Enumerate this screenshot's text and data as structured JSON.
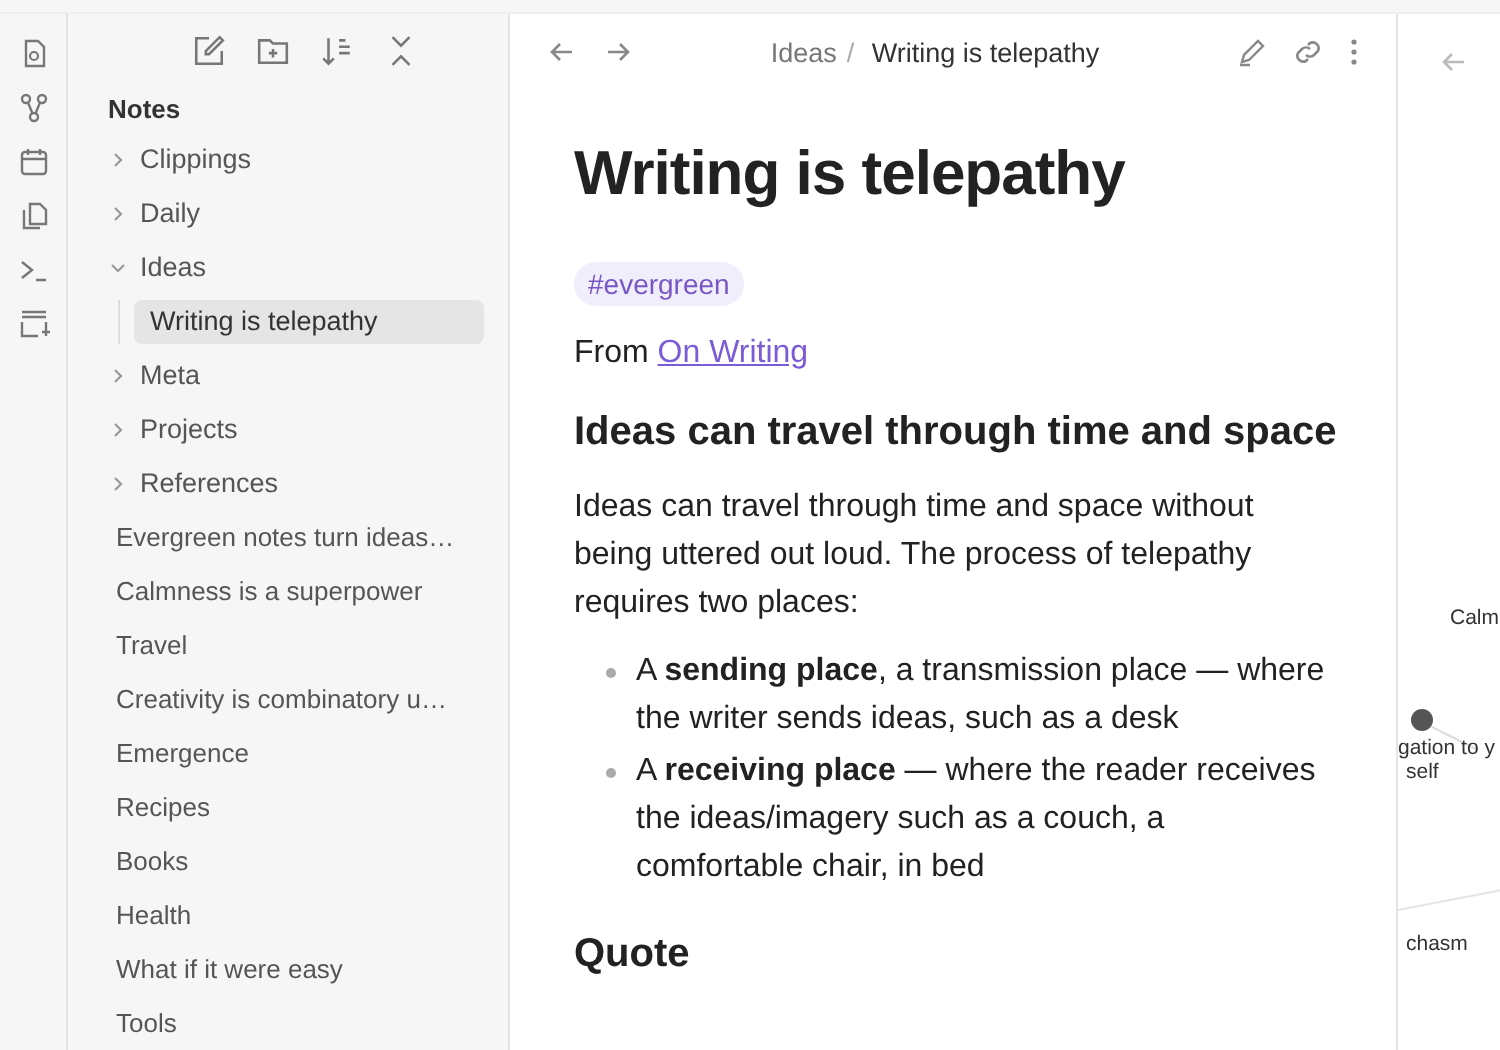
{
  "sidebar": {
    "heading": "Notes",
    "items": [
      {
        "kind": "folder",
        "label": "Clippings",
        "expanded": false
      },
      {
        "kind": "folder",
        "label": "Daily",
        "expanded": false
      },
      {
        "kind": "folder",
        "label": "Ideas",
        "expanded": true,
        "children": [
          {
            "label": "Writing is telepathy",
            "selected": true
          }
        ]
      },
      {
        "kind": "folder",
        "label": "Meta",
        "expanded": false
      },
      {
        "kind": "folder",
        "label": "Projects",
        "expanded": false
      },
      {
        "kind": "folder",
        "label": "References",
        "expanded": false
      },
      {
        "kind": "note",
        "label": "Evergreen notes turn ideas…",
        "selected": false
      },
      {
        "kind": "note",
        "label": "Calmness is a superpower",
        "selected": false
      },
      {
        "kind": "note",
        "label": "Travel",
        "selected": false
      },
      {
        "kind": "note",
        "label": "Creativity is combinatory u…",
        "selected": false
      },
      {
        "kind": "note",
        "label": "Emergence",
        "selected": false
      },
      {
        "kind": "note",
        "label": "Recipes",
        "selected": false
      },
      {
        "kind": "note",
        "label": "Books",
        "selected": false
      },
      {
        "kind": "note",
        "label": "Health",
        "selected": false
      },
      {
        "kind": "note",
        "label": "What if it were easy",
        "selected": false
      },
      {
        "kind": "note",
        "label": "Tools",
        "selected": false
      }
    ]
  },
  "editor": {
    "breadcrumb": [
      "Ideas",
      "Writing is telepathy"
    ],
    "separator": "/",
    "title": "Writing is telepathy",
    "tag": "#evergreen",
    "blocks": [
      {
        "kind": "source",
        "text": "From",
        "link": "On Writing"
      },
      {
        "kind": "heading",
        "text": "Ideas can travel through time and space"
      },
      {
        "kind": "paragraph",
        "text": "Ideas can travel through time and space without being uttered out loud. The process of telepathy requires two places:"
      },
      {
        "kind": "bullets",
        "items": [
          "A **sending place**, a transmission place — where the writer sends ideas, such as a desk",
          "A **receiving place** — where the reader receives the ideas/imagery such as a couch, a comfortable chair, in bed"
        ]
      },
      {
        "kind": "heading",
        "text": "Quote"
      }
    ]
  },
  "graph": {
    "labels": [
      "Calm",
      "gation to y",
      "self",
      "chasm"
    ]
  }
}
